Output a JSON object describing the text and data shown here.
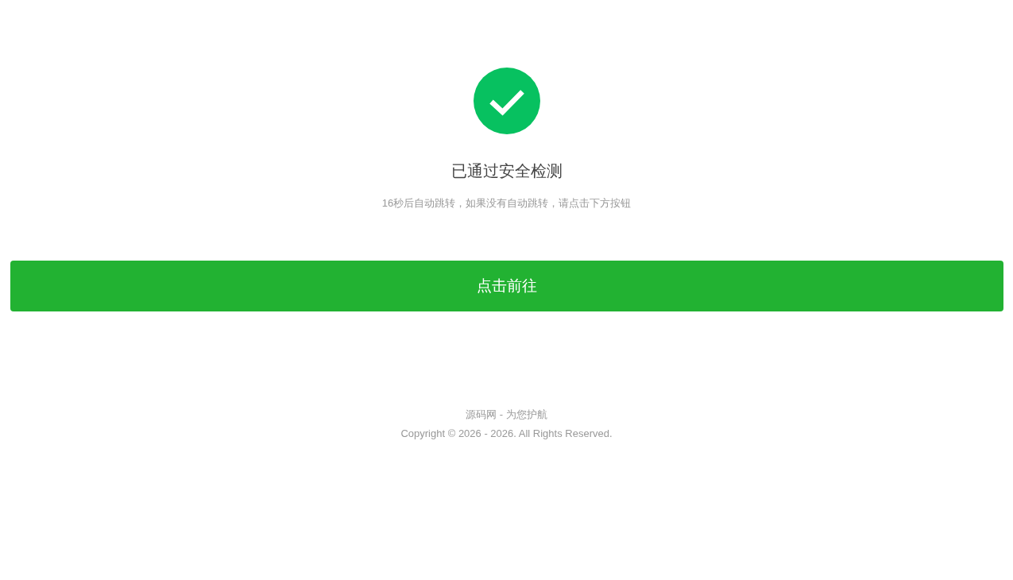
{
  "title": "已通过安全检测",
  "message": "16秒后自动跳转，如果没有自动跳转，请点击下方按钮",
  "button": {
    "label": "点击前往"
  },
  "footer": {
    "lines": [
      "源码网 - 为您护航",
      "Copyright © 2026 - 2026. All Rights Reserved."
    ]
  }
}
